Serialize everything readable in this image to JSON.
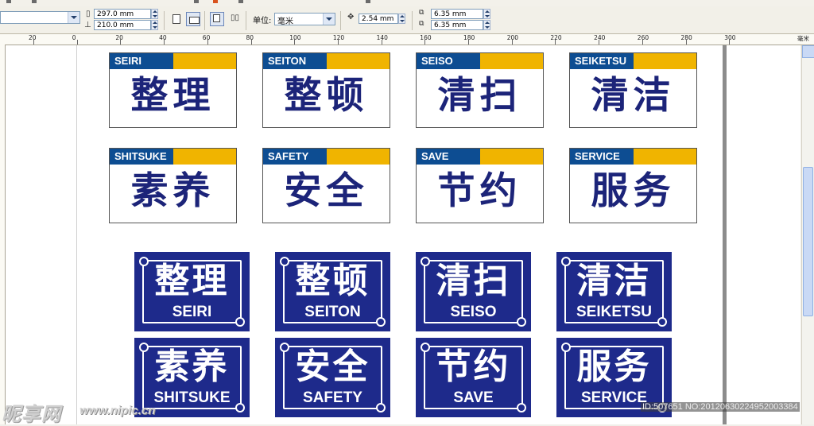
{
  "toolbar": {
    "page_width": "297.0 mm",
    "page_height": "210.0 mm",
    "units_label": "单位:",
    "units_value": "毫米",
    "nudge": "2.54 mm",
    "dup_x": "6.35 mm",
    "dup_y": "6.35 mm"
  },
  "ruler": {
    "labels": [
      "20",
      "0",
      "20",
      "40",
      "60",
      "80",
      "100",
      "120",
      "140",
      "160",
      "180",
      "200",
      "220",
      "240",
      "260",
      "280",
      "300"
    ],
    "unit": "毫米"
  },
  "white_signs": [
    {
      "en": "SEIRI",
      "cn": "整理"
    },
    {
      "en": "SEITON",
      "cn": "整顿"
    },
    {
      "en": "SEISO",
      "cn": "清扫"
    },
    {
      "en": "SEIKETSU",
      "cn": "清洁"
    },
    {
      "en": "SHITSUKE",
      "cn": "素养"
    },
    {
      "en": "SAFETY",
      "cn": "安全"
    },
    {
      "en": "SAVE",
      "cn": "节约"
    },
    {
      "en": "SERVICE",
      "cn": "服务"
    }
  ],
  "blue_signs": [
    {
      "cn": "整理",
      "en": "SEIRI"
    },
    {
      "cn": "整顿",
      "en": "SEITON"
    },
    {
      "cn": "清扫",
      "en": "SEISO"
    },
    {
      "cn": "清洁",
      "en": "SEIKETSU"
    },
    {
      "cn": "素养",
      "en": "SHITSUKE"
    },
    {
      "cn": "安全",
      "en": "SAFETY"
    },
    {
      "cn": "节约",
      "en": "SAVE"
    },
    {
      "cn": "服务",
      "en": "SERVICE"
    }
  ],
  "watermark": {
    "logo": "昵享网",
    "url": "www.nipic.cn",
    "id": "ID:507651 NO:20120630224952003384"
  },
  "colors": {
    "sign_blue": "#1e2a8b",
    "band_blue": "#0d4d92",
    "band_yellow": "#f0b400",
    "text_navy": "#1c2479"
  }
}
